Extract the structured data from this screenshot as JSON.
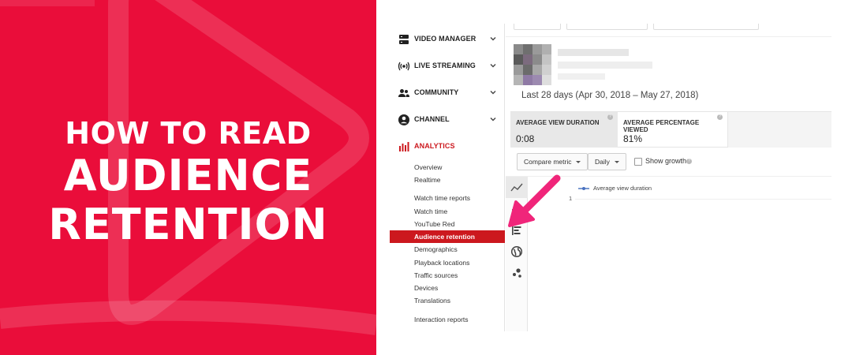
{
  "banner": {
    "line1": "HOW TO READ",
    "line2": "AUDIENCE",
    "line3": "RETENTION",
    "background_color": "#ea0d3a",
    "text_color": "#ffffff"
  },
  "sidebar": {
    "main_items": [
      {
        "label": "VIDEO MANAGER",
        "icon": "video-manager-icon",
        "expandable": true
      },
      {
        "label": "LIVE STREAMING",
        "icon": "live-streaming-icon",
        "expandable": true
      },
      {
        "label": "COMMUNITY",
        "icon": "community-icon",
        "expandable": true
      },
      {
        "label": "CHANNEL",
        "icon": "channel-icon",
        "expandable": true
      },
      {
        "label": "ANALYTICS",
        "icon": "analytics-icon",
        "expandable": false,
        "active": true
      }
    ],
    "sub_items": [
      "Overview",
      "Realtime",
      "Watch time reports",
      "Watch time",
      "YouTube Red",
      "Audience retention",
      "Demographics",
      "Playback locations",
      "Traffic sources",
      "Devices",
      "Translations",
      "Interaction reports"
    ],
    "active_sub": "Audience retention",
    "accent_color": "#cc181e"
  },
  "content": {
    "date_range": "Last 28 days (Apr 30, 2018 – May 27, 2018)",
    "metrics": [
      {
        "label": "AVERAGE VIEW DURATION",
        "value": "0:08"
      },
      {
        "label": "AVERAGE PERCENTAGE VIEWED",
        "value": "81%"
      }
    ],
    "controls": {
      "compare_metric": "Compare metric",
      "interval": "Daily",
      "show_growth": "Show growth",
      "show_growth_checked": false
    },
    "view_tabs": [
      "line-chart-icon",
      "bar-chart-icon",
      "list-chart-icon",
      "globe-icon",
      "bubble-chart-icon"
    ],
    "legend_label": "Average view duration",
    "y_tick": "1",
    "arrow_color": "#f0257a"
  }
}
